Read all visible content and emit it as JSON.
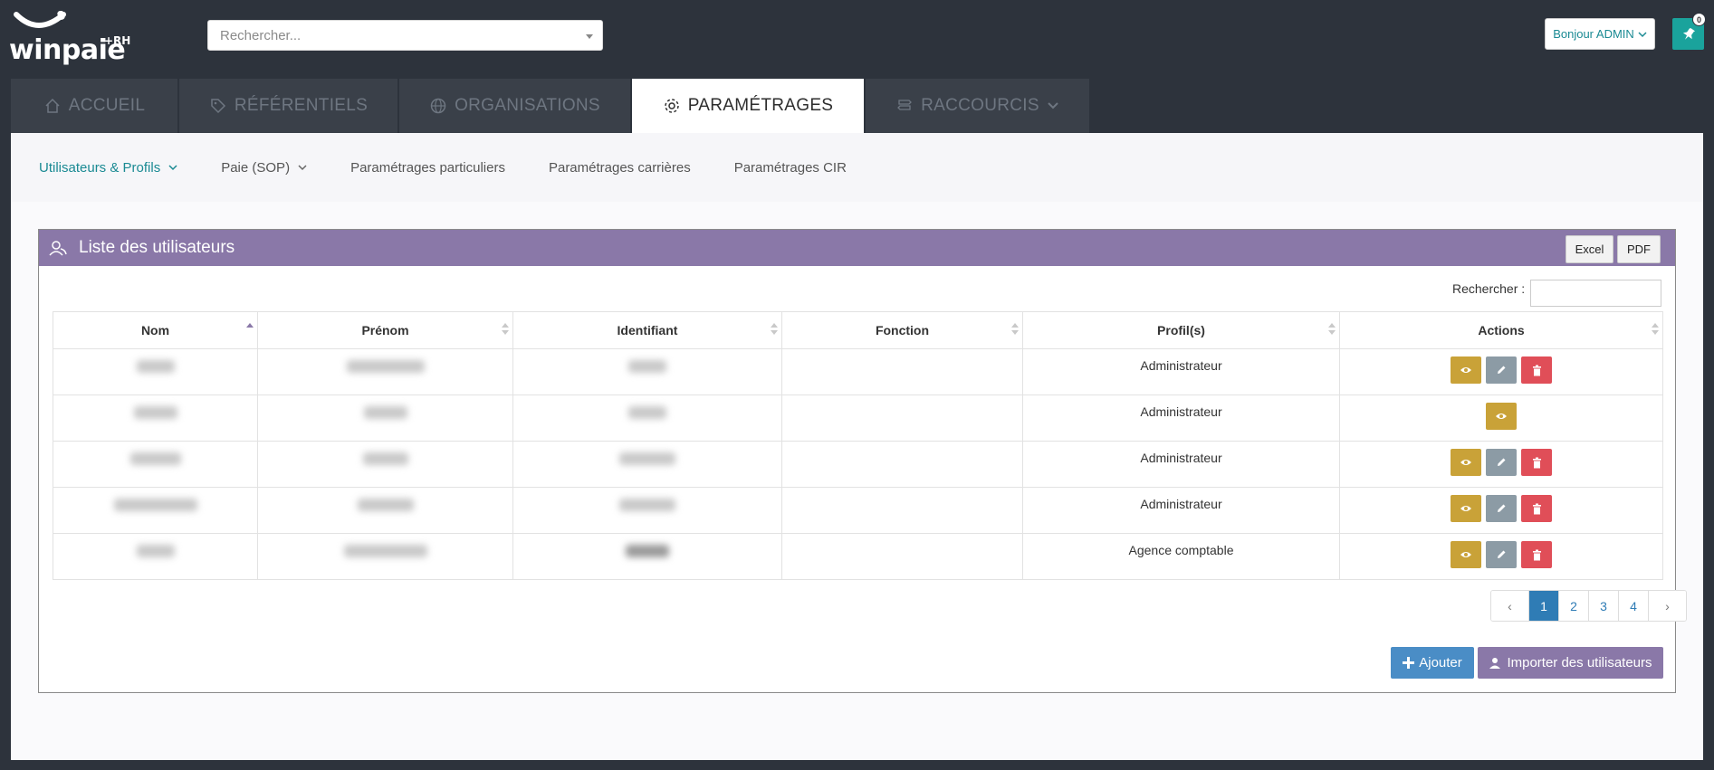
{
  "brand": {
    "name": "winpaie",
    "suffix": "+RH"
  },
  "header": {
    "search_placeholder": "Rechercher...",
    "user_greeting": "Bonjour ADMIN",
    "pin_count": "0"
  },
  "tabs": [
    {
      "label": "ACCUEIL",
      "icon": "home-icon"
    },
    {
      "label": "RÉFÉRENTIELS",
      "icon": "tag-icon"
    },
    {
      "label": "ORGANISATIONS",
      "icon": "globe-icon"
    },
    {
      "label": "PARAMÉTRAGES",
      "icon": "gear-icon",
      "active": true
    },
    {
      "label": "RACCOURCIS",
      "icon": "signpost-icon"
    }
  ],
  "subnav": [
    {
      "label": "Utilisateurs & Profils",
      "active": true
    },
    {
      "label": "Paie (SOP)"
    },
    {
      "label": "Paramétrages particuliers"
    },
    {
      "label": "Paramétrages carrières"
    },
    {
      "label": "Paramétrages CIR"
    }
  ],
  "list": {
    "title": "Liste des utilisateurs",
    "excel_label": "Excel",
    "pdf_label": "PDF",
    "filter_label": "Rechercher :",
    "columns": [
      "Nom",
      "Prénom",
      "Identifiant",
      "Fonction",
      "Profil(s)",
      "Actions"
    ],
    "rows": [
      {
        "profil": "Administrateur"
      },
      {
        "profil": "Administrateur"
      },
      {
        "profil": "Administrateur"
      },
      {
        "profil": "Administrateur"
      },
      {
        "profil": "Agence comptable"
      }
    ],
    "pages": [
      "‹",
      "1",
      "2",
      "3",
      "4",
      "›"
    ],
    "current_page": "1",
    "add_label": "Ajouter",
    "import_label": "Importer des utilisateurs"
  },
  "colors": {
    "accent_teal": "#1a8a93",
    "box_header": "#8a78a8",
    "view_button": "#c9a238",
    "edit_button": "#8c9ba5",
    "delete_button": "#e04e58",
    "primary": "#2f7cb5"
  }
}
